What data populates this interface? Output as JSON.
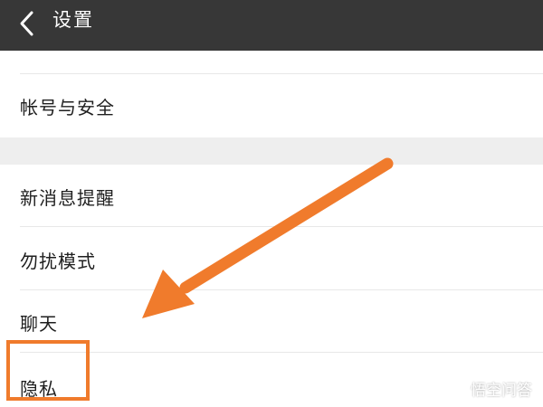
{
  "header": {
    "title": "设置",
    "back_icon": "chevron-left-icon",
    "background": "#373737"
  },
  "settings": {
    "account_security": "帐号与安全",
    "new_message_alert": "新消息提醒",
    "do_not_disturb": "勿扰模式",
    "chat": "聊天",
    "privacy": "隐私"
  },
  "annotation": {
    "color": "#f07b2c",
    "arrow_icon": "arrow-pointer",
    "highlight_target": "隐私"
  },
  "watermark": {
    "text": "悟空问答",
    "icon": "eye-logo-icon"
  }
}
